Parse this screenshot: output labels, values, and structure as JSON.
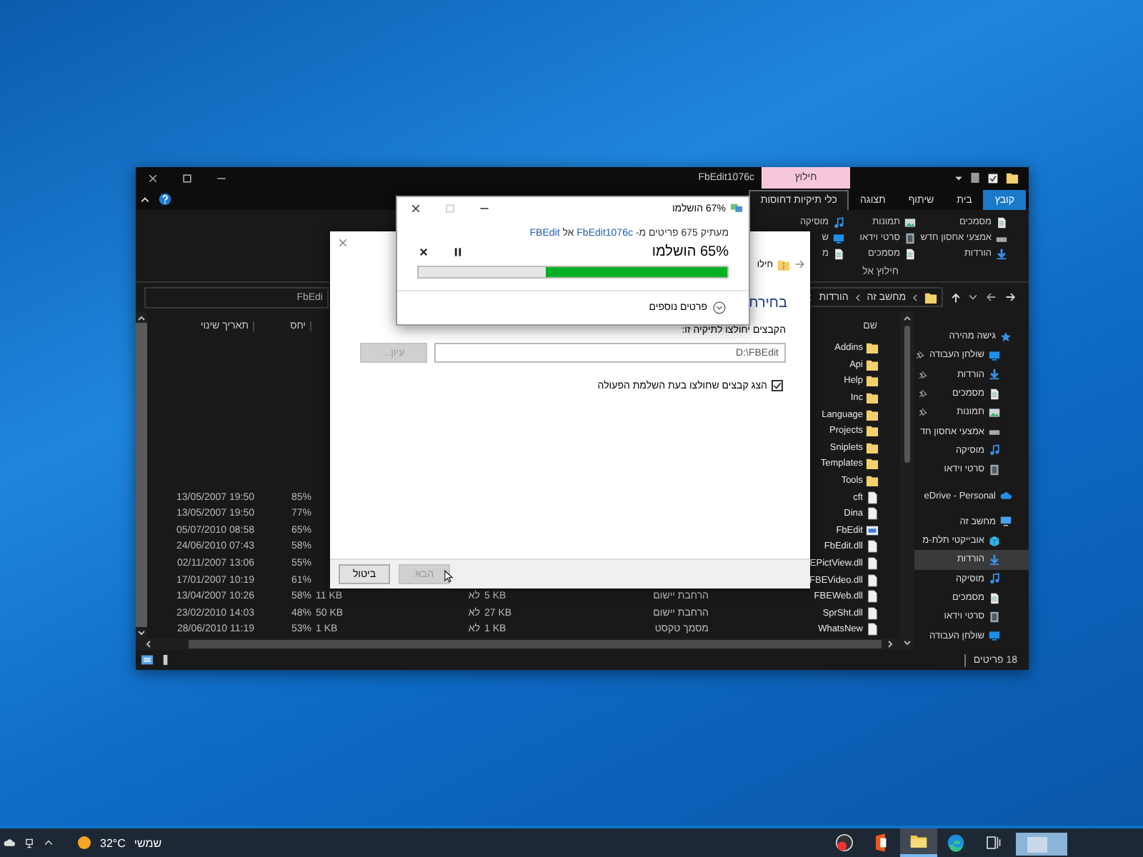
{
  "explorer": {
    "title": "FbEdit1076c",
    "context_tab": "חילוץ",
    "ribbon_tabs": [
      {
        "label": "קובץ",
        "kind": "file",
        "selected": false
      },
      {
        "label": "בית",
        "kind": "tab",
        "selected": false
      },
      {
        "label": "שיתוף",
        "kind": "tab",
        "selected": false
      },
      {
        "label": "תצוגה",
        "kind": "tab",
        "selected": false
      },
      {
        "label": "כלי תיקיות דחוסות",
        "kind": "tab",
        "selected": true
      }
    ],
    "ribbon_columns": [
      [
        {
          "label": "מסמכים",
          "kind": "document"
        },
        {
          "label": "אמצעי אחסון חדש",
          "kind": "drive"
        },
        {
          "label": "הורדות",
          "kind": "download"
        }
      ],
      [
        {
          "label": "תמונות",
          "kind": "picture"
        },
        {
          "label": "סרטי וידאו",
          "kind": "video"
        },
        {
          "label": "מסמכים",
          "kind": "document"
        }
      ],
      [
        {
          "label": "מוסיקה",
          "kind": "music"
        },
        {
          "label": "ש",
          "kind": "desktop"
        },
        {
          "label": "מ",
          "kind": "document"
        }
      ]
    ],
    "ribbon_group": "חילוץ אל",
    "breadcrumbs": [
      "מחשב זה",
      "הורדות"
    ],
    "search": {
      "placeholder": "FbEdi"
    },
    "columns": {
      "date": "תאריך שינוי",
      "ratio": "יחס",
      "name": "שם"
    },
    "files": [
      {
        "name": "Addins",
        "kind": "folder"
      },
      {
        "name": "Api",
        "kind": "folder"
      },
      {
        "name": "Help",
        "kind": "folder"
      },
      {
        "name": "Inc",
        "kind": "folder"
      },
      {
        "name": "Language",
        "kind": "folder"
      },
      {
        "name": "Projects",
        "kind": "folder"
      },
      {
        "name": "Sniplets",
        "kind": "folder"
      },
      {
        "name": "Templates",
        "kind": "folder"
      },
      {
        "name": "Tools",
        "kind": "folder"
      },
      {
        "name": "cft",
        "kind": "file",
        "date": "13/05/2007 19:50",
        "ratio": "85%"
      },
      {
        "name": "Dina",
        "kind": "file",
        "date": "13/05/2007 19:50",
        "ratio": "77%"
      },
      {
        "name": "FbEdit",
        "kind": "app",
        "date": "05/07/2010 08:58",
        "ratio": "65%"
      },
      {
        "name": "FbEdit.dll",
        "kind": "file",
        "date": "24/06/2010 07:43",
        "ratio": "58%"
      },
      {
        "name": "EPictView.dll",
        "kind": "file",
        "date": "02/11/2007 13:06",
        "ratio": "55%"
      },
      {
        "name": "FBEVideo.dll",
        "kind": "file",
        "date": "17/01/2007 10:19",
        "ratio": "61%"
      },
      {
        "name": "FBEWeb.dll",
        "kind": "file",
        "date": "13/04/2007 10:26",
        "ratio": "58%",
        "size": "11 KB",
        "protected": "לא",
        "packed": "5 KB",
        "type": "הרחבת יישום"
      },
      {
        "name": "SprSht.dll",
        "kind": "file",
        "date": "23/02/2010 14:03",
        "ratio": "48%",
        "size": "50 KB",
        "protected": "לא",
        "packed": "27 KB",
        "type": "הרחבת יישום"
      },
      {
        "name": "WhatsNew",
        "kind": "file",
        "date": "28/06/2010 11:19",
        "ratio": "53%",
        "size": "1 KB",
        "protected": "לא",
        "packed": "1 KB",
        "type": "מסמך טקסט"
      }
    ],
    "nav": [
      {
        "label": "גישה מהירה",
        "kind": "star",
        "selected": false,
        "children": [
          {
            "label": "שולחן העבודה",
            "kind": "desktop",
            "pinned": true,
            "selected": false
          },
          {
            "label": "הורדות",
            "kind": "download",
            "pinned": true,
            "selected": false
          },
          {
            "label": "מסמכים",
            "kind": "document",
            "pinned": true,
            "selected": false
          },
          {
            "label": "תמונות",
            "kind": "picture",
            "pinned": true,
            "selected": false
          },
          {
            "label": "אמצעי אחסון חד",
            "kind": "drive",
            "pinned": false,
            "selected": false
          },
          {
            "label": "מוסיקה",
            "kind": "music",
            "pinned": false,
            "selected": false
          },
          {
            "label": "סרטי וידאו",
            "kind": "video",
            "pinned": false,
            "selected": false
          }
        ]
      },
      {
        "label": "eDrive - Personal",
        "kind": "cloud",
        "selected": false
      },
      {
        "label": "מחשב זה",
        "kind": "pc",
        "selected": false,
        "children": [
          {
            "label": "אובייקטי תלת-מ",
            "kind": "cube",
            "pinned": false,
            "selected": false
          },
          {
            "label": "הורדות",
            "kind": "download",
            "pinned": false,
            "selected": true
          },
          {
            "label": "מוסיקה",
            "kind": "music",
            "pinned": false,
            "selected": false
          },
          {
            "label": "מסמכים",
            "kind": "document",
            "pinned": false,
            "selected": false
          },
          {
            "label": "סרטי וידאו",
            "kind": "video",
            "pinned": false,
            "selected": false
          },
          {
            "label": "שולחן העבודה",
            "kind": "desktop",
            "pinned": false,
            "selected": false
          }
        ]
      }
    ],
    "status": "18 פריטים"
  },
  "extract_dialog": {
    "title": "חילו",
    "heading": "בחירת",
    "folder_label": "הקבצים יחולצו לתיקיה זו:",
    "folder_value": "D:\\FBEdit",
    "browse": {
      "label": "עיון...",
      "disabled": true
    },
    "show_files": {
      "label": "הצג קבצים שחולצו בעת השלמת הפעולה",
      "checked": true
    },
    "buttons": [
      {
        "label": "הבא",
        "disabled": true
      },
      {
        "label": "ביטול",
        "disabled": false
      }
    ]
  },
  "progress_dialog": {
    "title": "67% הושלמו",
    "copy_text": {
      "prefix": "מעתיק 675 פריטים מ-",
      "source": "FbEdit1076c",
      "middle": "אל",
      "destination": "FBEdit"
    },
    "percent_text": "65% הושלמו",
    "level": 0.59,
    "details": "פרטים נוספים"
  },
  "taskbar": {
    "temperature": "32°C",
    "condition": "שמשי",
    "apps": [
      {
        "kind": "gauge",
        "selected": false
      },
      {
        "kind": "office",
        "selected": false
      },
      {
        "kind": "explorer",
        "selected": true
      },
      {
        "kind": "edge",
        "selected": false
      },
      {
        "kind": "taskview",
        "selected": false
      },
      {
        "kind": "widget",
        "selected": false
      }
    ]
  }
}
